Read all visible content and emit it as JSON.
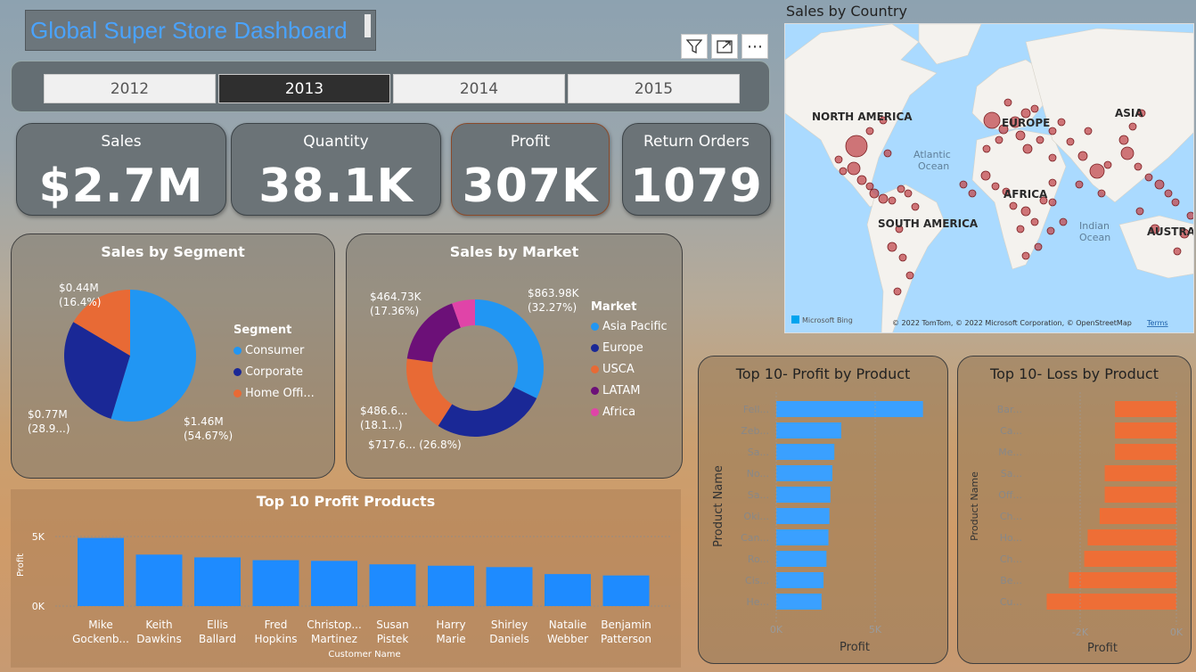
{
  "header": {
    "title": "Global Super Store Dashboard"
  },
  "visual_toolbar": {
    "filter_icon": "filter-icon",
    "focus_icon": "focus-mode-icon",
    "more_icon": "more-options-icon",
    "more_label": "⋯"
  },
  "year_slicer": {
    "years": [
      "2012",
      "2013",
      "2014",
      "2015"
    ],
    "selected": "2013"
  },
  "kpis": [
    {
      "label": "Sales",
      "value": "$2.7M"
    },
    {
      "label": "Quantity",
      "value": "38.1K"
    },
    {
      "label": "Profit",
      "value": "307K"
    },
    {
      "label": "Return Orders",
      "value": "1079"
    }
  ],
  "segment_chart": {
    "title": "Sales by Segment",
    "legend_title": "Segment",
    "legend": [
      "Consumer",
      "Corporate",
      "Home Offi..."
    ],
    "labels": {
      "home_office": [
        "$0.44M",
        "(16.4%)"
      ],
      "corporate": [
        "$0.77M",
        "(28.9...)"
      ],
      "consumer": [
        "$1.46M",
        "(54.67%)"
      ]
    }
  },
  "market_chart": {
    "title": "Sales by Market",
    "legend_title": "Market",
    "legend": [
      "Asia Pacific",
      "Europe",
      "USCA",
      "LATAM",
      "Africa"
    ],
    "labels": {
      "asia_pacific": [
        "$863.98K",
        "(32.27%)"
      ],
      "europe": [
        "$717.6... (26.8%)"
      ],
      "usca": [
        "$486.6...",
        "(18.1...)"
      ],
      "latam": [
        "$464.73K",
        "(17.36%)"
      ]
    }
  },
  "map": {
    "title": "Sales by Country",
    "labels": {
      "na": "NORTH AMERICA",
      "sa": "SOUTH AMERICA",
      "eu": "EUROPE",
      "af": "AFRICA",
      "as": "ASIA",
      "au": "AUSTRAL",
      "atl1": "Atlantic",
      "atl2": "Ocean",
      "ind1": "Indian",
      "ind2": "Ocean"
    },
    "attribution": "© 2022 TomTom, © 2022 Microsoft Corporation, © OpenStreetMap",
    "terms": "Terms",
    "bing": "Microsoft Bing"
  },
  "colors": {
    "blue": "#2196f3",
    "navy": "#1a2896",
    "orange": "#e86a35",
    "purple": "#6c1078",
    "pink": "#e044a8",
    "bar_blue": "#3aa0ff",
    "bar_orange": "#ee6e36"
  },
  "chart_data": [
    {
      "type": "pie",
      "title": "Sales by Segment",
      "categories": [
        "Consumer",
        "Corporate",
        "Home Office"
      ],
      "values": [
        1.46,
        0.77,
        0.44
      ],
      "percent": [
        54.67,
        28.9,
        16.4
      ],
      "unit": "$M",
      "legend": "right"
    },
    {
      "type": "pie",
      "title": "Sales by Market",
      "categories": [
        "Asia Pacific",
        "Europe",
        "USCA",
        "LATAM",
        "Africa"
      ],
      "values": [
        863.98,
        717.6,
        486.6,
        464.73,
        146
      ],
      "percent": [
        32.27,
        26.8,
        18.1,
        17.36,
        5.47
      ],
      "unit": "$K",
      "donut": true,
      "legend": "right"
    },
    {
      "type": "bar",
      "title": "Top 10 Profit Products",
      "categories": [
        [
          "Mike",
          "Gockenb..."
        ],
        [
          "Keith",
          "Dawkins"
        ],
        [
          "Ellis",
          "Ballard"
        ],
        [
          "Fred",
          "Hopkins"
        ],
        [
          "Christop...",
          "Martinez"
        ],
        [
          "Susan",
          "Pistek"
        ],
        [
          "Harry",
          "Marie"
        ],
        [
          "Shirley",
          "Daniels"
        ],
        [
          "Natalie",
          "Webber"
        ],
        [
          "Benjamin",
          "Patterson"
        ]
      ],
      "values": [
        4900,
        3700,
        3500,
        3300,
        3250,
        3000,
        2900,
        2800,
        2300,
        2200
      ],
      "xlabel": "Customer Name",
      "ylabel": "Profit",
      "ylim": [
        0,
        5000
      ],
      "yticks": [
        "0K",
        "5K"
      ],
      "grid": true
    },
    {
      "type": "bar",
      "orientation": "horizontal",
      "title": "Top 10- Profit by Product",
      "categories": [
        "Fell...",
        "Zeb...",
        "Sa...",
        "No...",
        "Sa...",
        "Oki...",
        "Can...",
        "Ro...",
        "Cis...",
        "He..."
      ],
      "values": [
        7450,
        3300,
        2950,
        2850,
        2750,
        2700,
        2650,
        2550,
        2400,
        2300
      ],
      "xlabel": "Profit",
      "ylabel": "Product Name",
      "xlim": [
        0,
        8000
      ],
      "xticks": [
        "0K",
        "5K"
      ]
    },
    {
      "type": "bar",
      "orientation": "horizontal",
      "title": "Top 10- Loss by Product",
      "categories": [
        "Bar...",
        "Ca...",
        "Me...",
        "Sa...",
        "Off...",
        "Ch...",
        "Ho...",
        "Ch...",
        "Be...",
        "Cu..."
      ],
      "values": [
        -1800,
        -1800,
        -1800,
        -2100,
        -2100,
        -2250,
        -2600,
        -2700,
        -3150,
        -3800
      ],
      "xlabel": "Profit",
      "ylabel": "Product Name",
      "xlim": [
        -3800,
        0
      ],
      "xticks": [
        "-2K",
        "0K"
      ]
    }
  ]
}
